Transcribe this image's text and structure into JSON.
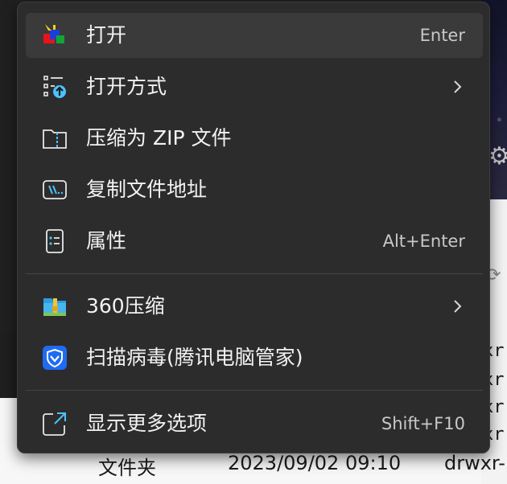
{
  "menu": {
    "items": [
      {
        "label": "打开",
        "shortcut": "Enter",
        "icon": "colorful-app-icon",
        "submenu": false,
        "highlighted": true
      },
      {
        "label": "打开方式",
        "shortcut": "",
        "icon": "open-with-icon",
        "submenu": true
      },
      {
        "label": "压缩为 ZIP 文件",
        "shortcut": "",
        "icon": "zip-folder-icon",
        "submenu": false
      },
      {
        "label": "复制文件地址",
        "shortcut": "",
        "icon": "copy-path-icon",
        "submenu": false
      },
      {
        "label": "属性",
        "shortcut": "Alt+Enter",
        "icon": "properties-icon",
        "submenu": false
      },
      {
        "label": "360压缩",
        "shortcut": "",
        "icon": "360-compress-icon",
        "submenu": true
      },
      {
        "label": "扫描病毒(腾讯电脑管家)",
        "shortcut": "",
        "icon": "tencent-shield-icon",
        "submenu": false
      },
      {
        "label": "显示更多选项",
        "shortcut": "Shift+F10",
        "icon": "show-more-icon",
        "submenu": false
      }
    ]
  },
  "background": {
    "row_type": "文件夹",
    "row_date": "2023/09/02 09:10",
    "row_perm": "drwxr-",
    "perm_fragments": [
      "xr-",
      "xr-",
      "xr-",
      "xr-",
      "xr-"
    ]
  },
  "colors": {
    "menu_bg": "#2c2c2c",
    "highlight": "#3a3a3a",
    "accent": "#4cc2ff"
  }
}
